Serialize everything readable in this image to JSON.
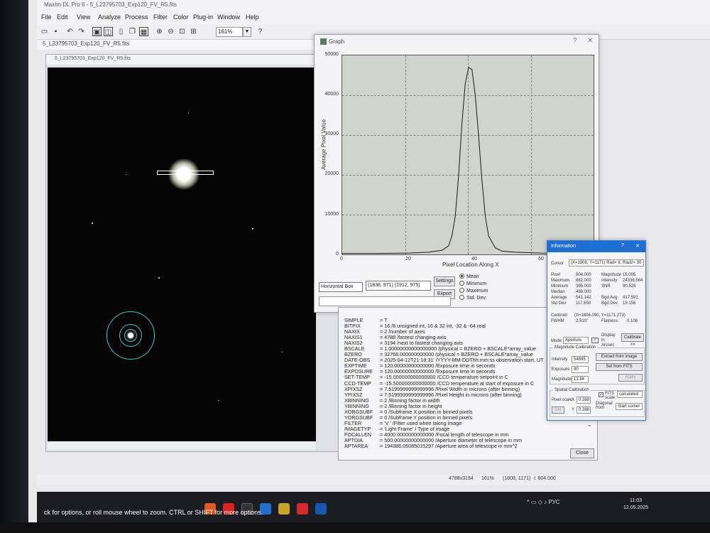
{
  "app": {
    "window_title": "MaxIm DL Pro 6 - 5_L23795703_Exp120_FV_R5.fits",
    "menu": [
      "File",
      "Edit",
      "View",
      "Analyze",
      "Process",
      "Filter",
      "Color",
      "Plug-in",
      "Window",
      "Help"
    ],
    "zoom": "161%",
    "doc_tab": "5_L23795703_Exp120_FV_R5.fits",
    "image_window_title": "5_L23795703_Exp120_FV_R5.fits"
  },
  "graph": {
    "title": "Graph",
    "chart_data": {
      "type": "line",
      "xlabel": "Pixel Location Along X",
      "ylabel": "Average Pixel Value",
      "xlim": [
        0,
        76
      ],
      "ylim": [
        0,
        50000
      ],
      "x_ticks": [
        0,
        20,
        40,
        60
      ],
      "y_ticks": [
        0,
        10000,
        20000,
        30000,
        40000,
        50000
      ],
      "grid": true,
      "series": [
        {
          "x": [
            0,
            10,
            20,
            26,
            30,
            32,
            33,
            34,
            35,
            36,
            37,
            38,
            39,
            40,
            41,
            42,
            43,
            44,
            46,
            48,
            52,
            60,
            76
          ],
          "values": [
            600,
            600,
            700,
            900,
            1400,
            2500,
            5000,
            10000,
            20000,
            33000,
            43000,
            47000,
            46500,
            40000,
            30000,
            19000,
            10000,
            5000,
            2000,
            1200,
            900,
            700,
            600
          ]
        }
      ]
    },
    "mode_select": "Horizontal Box",
    "coordinates": "(1838, 971) (1912, 975)",
    "settings_label": "Settings",
    "export_label": "Export",
    "radios": [
      "Mean",
      "Minimum",
      "Maximum",
      "Std. Dev."
    ],
    "selected_radio": "Mean"
  },
  "fits_header": {
    "rows": [
      [
        "SIMPLE",
        "= T"
      ],
      [
        "BITPIX",
        "= 16 /8 unsigned int, 16 & 32 int, -32 & -64 real"
      ],
      [
        "NAXIS",
        "= 2 /number of axes"
      ],
      [
        "NAXIS1",
        "= 4788 /fastest changing axis"
      ],
      [
        "NAXIS2",
        "= 3194 /next to fastest changing axis"
      ],
      [
        "BSCALE",
        "= 1.00000000000000000 /physical = BZERO + BSCALE*array_value"
      ],
      [
        "BZERO",
        "= 32768.000000000000 /physical = BZERO + BSCALE*array_value"
      ],
      [
        "DATE-OBS",
        "= 2025-04-12T21:18:31' /YYYY-MM-DDThh:mm:ss observation start, UT"
      ],
      [
        "EXPTIME",
        "= 120.00000000000000 /Exposure time in seconds"
      ],
      [
        "EXPOSURE",
        "= 120.00000000000000 /Exposure time in seconds"
      ],
      [
        "SET-TEMP",
        "= -15.000000000000000 /CCD temperature setpoint in C"
      ],
      [
        "CCD-TEMP",
        "= -15.500000000000000 /CCD temperature at start of exposure in C"
      ],
      [
        "XPIXSZ",
        "= 7.5199999999999996 /Pixel Width in microns (after binning)"
      ],
      [
        "YPIXSZ",
        "= 7.5199999999999996 /Pixel Height in microns (after binning)"
      ],
      [
        "XBINNING",
        "= 2 /Binning factor in width"
      ],
      [
        "YBINNING",
        "= 2 /Binning factor in height"
      ],
      [
        "XORGSUBF",
        "= 0 /Subframe X position in binned pixels"
      ],
      [
        "YORGSUBF",
        "= 0 /Subframe Y position in binned pixels"
      ],
      [
        "FILTER",
        "= 'V ' /Filter used when taking image"
      ],
      [
        "IMAGETYP",
        "= 'Light Frame' / Type of image"
      ],
      [
        "FOCALLEN",
        "= 4000.0000000000000 /Focal length of telescope in mm"
      ],
      [
        "APTDIA",
        "= 500.00000000000000 /Aperture diameter of telescope in mm"
      ],
      [
        "APTAREA",
        "= 194386.05085015297 /Aperture area of telescope in mm^2"
      ]
    ],
    "close_label": "Close"
  },
  "info": {
    "title": "Information",
    "cursor_label": "Cursor",
    "cursor_value": "(X=1808, Y=1171) Rad= 8, Rad2= 30",
    "left_labels": [
      "Pixel",
      "Maximum",
      "Minimum",
      "Median",
      "Average",
      "Std Dev"
    ],
    "left_values": [
      "804.000",
      "882.000",
      "395.000",
      "498.000",
      "541.142",
      "117.650"
    ],
    "right_labels": [
      "Magnitude",
      "Intensity",
      "SNR",
      "",
      "Bgd Avg",
      "Bgd Dev"
    ],
    "right_values": [
      "15.005",
      "24336.564",
      "90.528",
      "",
      "417.591",
      "19.156"
    ],
    "centroid_label": "Centroid",
    "centroid_value": "(X=1806.090, Y=1171.273)",
    "fwhm_label": "FWHM",
    "fwhm_value": "2.510\"",
    "flatness_label": "Flatness",
    "flatness_value": "0.106",
    "mode_label": "Mode",
    "mode_value": "Aperture",
    "display_label": "Display in Arcsec",
    "calibrate_label": "Calibrate >>",
    "mag_cal_label": "Magnitude Calibration",
    "intensity_label": "Intensity",
    "intensity_value": "54895",
    "extract_label": "Extract from image",
    "exposure_label": "Exposure",
    "exposure_value": "90",
    "set_fits_label": "Set from FITS",
    "magnitude_label": "Magnitude",
    "magnitude_value": "13.84",
    "apply_label": "Apply",
    "spatial_label": "Spatial Calibration",
    "fits_scale_label": "FITS scale",
    "calculated_label": "calculated",
    "pixel_scale_label": "Pixel scale",
    "px_x": "0.388",
    "px_y": "0.388",
    "set_label": "Set",
    "diagonal_label": "Diagonal from",
    "diagonal_value": "Start corner"
  },
  "statusbar": {
    "dims": "4788x3194",
    "zoom": "161%",
    "coords": "(1808, 1171)",
    "value": "i: 804.000"
  },
  "hint": "ck for options, or roll mouse wheel to zoom. CTRL or SHIFT for more options.",
  "taskbar": {
    "tray": "^ ▭ ◇ ♪ PУC",
    "time": "11:03",
    "date": "12.05.2025"
  },
  "colors": {
    "aperture_rings": "#3cc6c6",
    "plot_bg": "#cfd5cc",
    "info_title": "#1e6fd1"
  }
}
